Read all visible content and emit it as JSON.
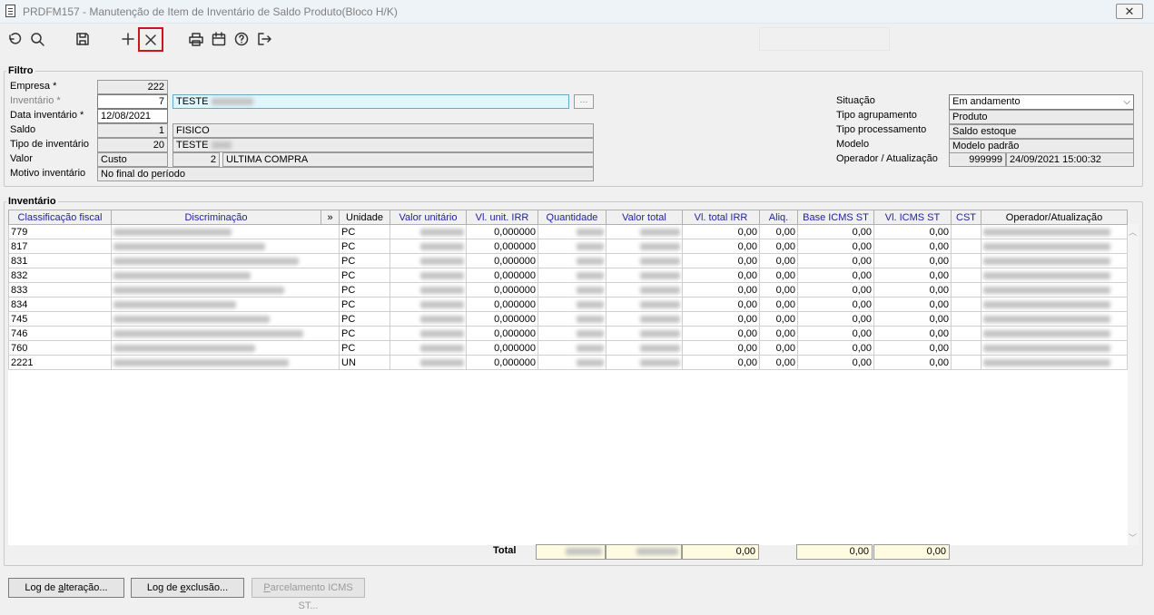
{
  "window": {
    "title": "PRDFM157 - Manutenção de Item de Inventário de Saldo Produto(Bloco H/K)",
    "close_label": "✕"
  },
  "toolbar": {
    "icons": [
      "undo-icon",
      "search-icon",
      "save-icon",
      "add-icon",
      "delete-icon",
      "print-icon",
      "calendar-icon",
      "help-icon",
      "exit-icon"
    ]
  },
  "filtro": {
    "legend": "Filtro",
    "empresa": {
      "label": "Empresa *",
      "value": "222"
    },
    "inventario": {
      "label": "Inventário *",
      "value": "7",
      "desc": "TESTE"
    },
    "data": {
      "label": "Data inventário *",
      "value": "12/08/2021"
    },
    "saldo": {
      "label": "Saldo",
      "value": "1",
      "desc": "FISICO"
    },
    "tipo_inventario": {
      "label": "Tipo de inventário",
      "value": "20",
      "desc": "TESTE"
    },
    "valor": {
      "label": "Valor",
      "value": "Custo",
      "code": "2",
      "desc": "ULTIMA COMPRA"
    },
    "motivo": {
      "label": "Motivo inventário",
      "value": "No final do período"
    },
    "situacao": {
      "label": "Situação",
      "value": "Em andamento"
    },
    "tipo_agrupamento": {
      "label": "Tipo agrupamento",
      "value": "Produto"
    },
    "tipo_processamento": {
      "label": "Tipo processamento",
      "value": "Saldo estoque"
    },
    "modelo": {
      "label": "Modelo",
      "value": "Modelo padrão"
    },
    "operador": {
      "label": "Operador / Atualização",
      "code": "999999",
      "datetime": "24/09/2021 15:00:32"
    }
  },
  "inventario": {
    "legend": "Inventário",
    "columns": [
      "Classificação fiscal",
      "Discriminação",
      "»",
      "Unidade",
      "Valor unitário",
      "Vl. unit. IRR",
      "Quantidade",
      "Valor total",
      "Vl. total IRR",
      "Aliq.",
      "Base ICMS ST",
      "Vl. ICMS ST",
      "CST",
      "Operador/Atualização"
    ],
    "rows": [
      {
        "cf": "779",
        "un": "PC",
        "vu_irr": "0,000000",
        "vt_irr": "0,00",
        "aliq": "0,00",
        "base": "0,00",
        "icms": "0,00"
      },
      {
        "cf": "817",
        "un": "PC",
        "vu_irr": "0,000000",
        "vt_irr": "0,00",
        "aliq": "0,00",
        "base": "0,00",
        "icms": "0,00"
      },
      {
        "cf": "831",
        "un": "PC",
        "vu_irr": "0,000000",
        "vt_irr": "0,00",
        "aliq": "0,00",
        "base": "0,00",
        "icms": "0,00"
      },
      {
        "cf": "832",
        "un": "PC",
        "vu_irr": "0,000000",
        "vt_irr": "0,00",
        "aliq": "0,00",
        "base": "0,00",
        "icms": "0,00"
      },
      {
        "cf": "833",
        "un": "PC",
        "vu_irr": "0,000000",
        "vt_irr": "0,00",
        "aliq": "0,00",
        "base": "0,00",
        "icms": "0,00"
      },
      {
        "cf": "834",
        "un": "PC",
        "vu_irr": "0,000000",
        "vt_irr": "0,00",
        "aliq": "0,00",
        "base": "0,00",
        "icms": "0,00"
      },
      {
        "cf": "745",
        "un": "PC",
        "vu_irr": "0,000000",
        "vt_irr": "0,00",
        "aliq": "0,00",
        "base": "0,00",
        "icms": "0,00"
      },
      {
        "cf": "746",
        "un": "PC",
        "vu_irr": "0,000000",
        "vt_irr": "0,00",
        "aliq": "0,00",
        "base": "0,00",
        "icms": "0,00"
      },
      {
        "cf": "760",
        "un": "PC",
        "vu_irr": "0,000000",
        "vt_irr": "0,00",
        "aliq": "0,00",
        "base": "0,00",
        "icms": "0,00"
      },
      {
        "cf": "2221",
        "un": "UN",
        "vu_irr": "0,000000",
        "vt_irr": "0,00",
        "aliq": "0,00",
        "base": "0,00",
        "icms": "0,00"
      }
    ],
    "totals": {
      "label": "Total",
      "vt_irr": "0,00",
      "base": "0,00",
      "icms": "0,00"
    }
  },
  "buttons": {
    "log_alteracao": {
      "pre": "Log de ",
      "key": "a",
      "post": "lteração..."
    },
    "log_exclusao": {
      "pre": "Log de ",
      "key": "e",
      "post": "xclusão..."
    },
    "parcelamento": {
      "pre": "",
      "key": "P",
      "post": "arcelamento ICMS ST..."
    }
  }
}
